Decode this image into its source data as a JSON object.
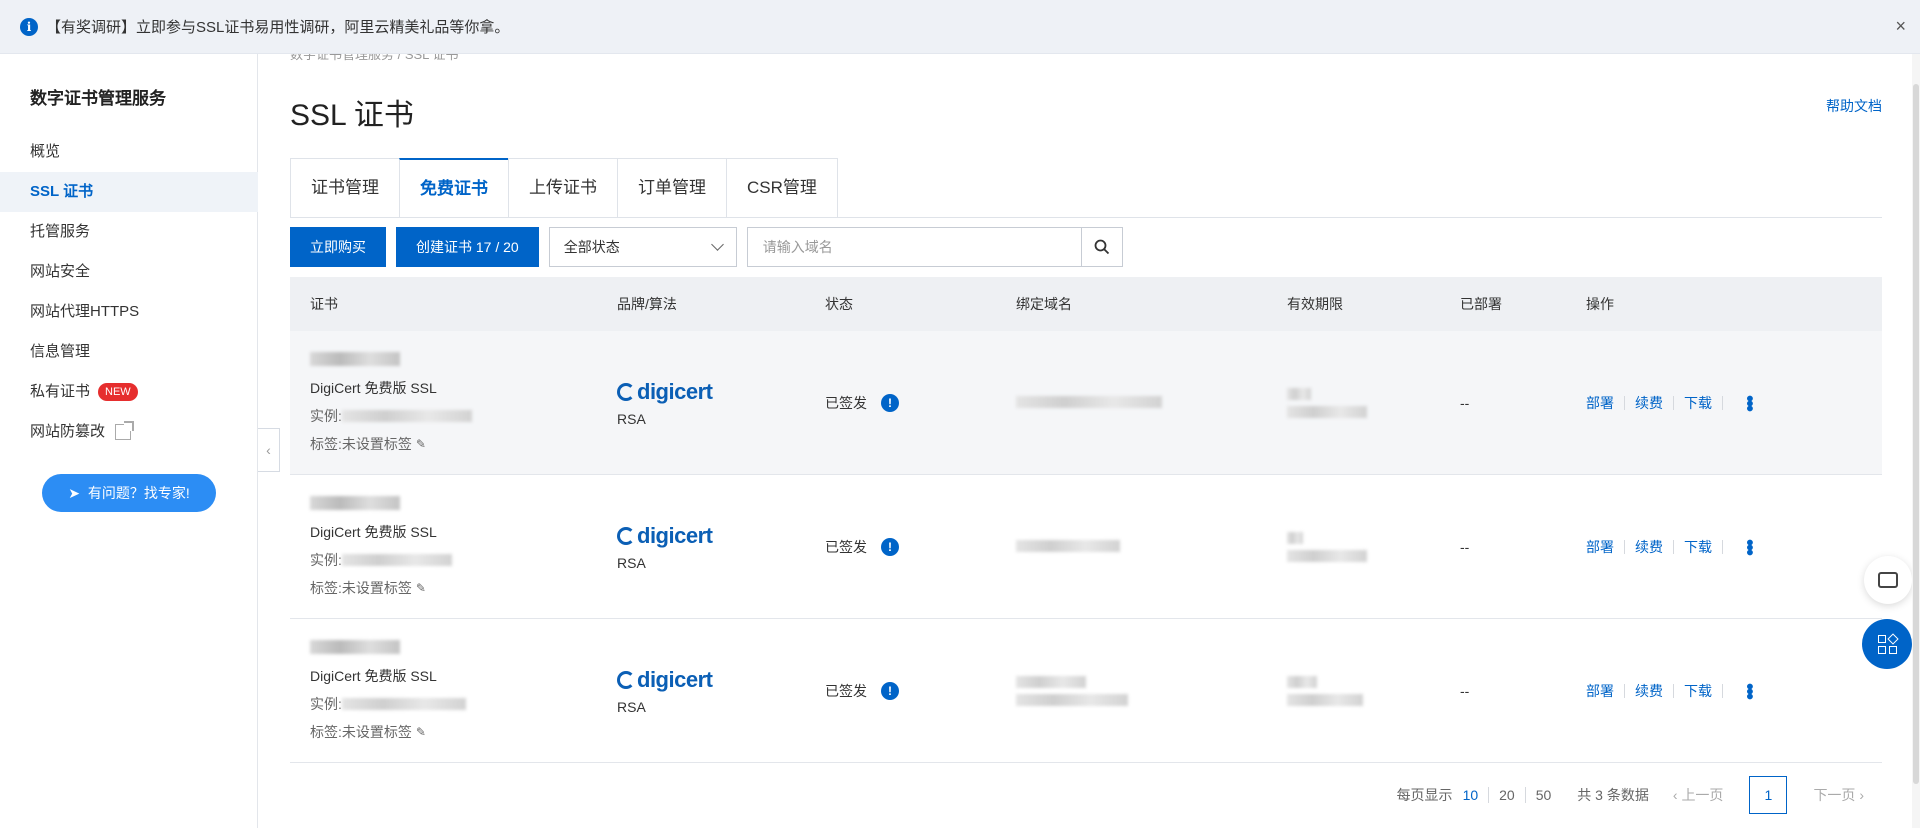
{
  "notice": {
    "icon": "info-icon",
    "text": "【有奖调研】立即参与SSL证书易用性调研，阿里云精美礼品等你拿。",
    "close": "×"
  },
  "sidebar": {
    "title": "数字证书管理服务",
    "items": [
      {
        "label": "概览"
      },
      {
        "label": "SSL 证书",
        "active": true
      },
      {
        "label": "托管服务"
      },
      {
        "label": "网站安全"
      },
      {
        "label": "网站代理HTTPS"
      },
      {
        "label": "信息管理"
      },
      {
        "label": "私有证书",
        "badge": "NEW"
      },
      {
        "label": "网站防篡改",
        "icon": "external-link-icon"
      }
    ],
    "expert_button": "有问题？找专家!",
    "collapse": "‹"
  },
  "main": {
    "breadcrumb": "数字证书管理服务  /  SSL 证书",
    "title": "SSL 证书",
    "help": "帮助文档",
    "tabs": [
      {
        "label": "证书管理"
      },
      {
        "label": "免费证书",
        "active": true
      },
      {
        "label": "上传证书"
      },
      {
        "label": "订单管理"
      },
      {
        "label": "CSR管理"
      }
    ],
    "toolbar": {
      "buy": "立即购买",
      "create": "创建证书 17 / 20",
      "status_select": "全部状态",
      "search_placeholder": "请输入域名"
    },
    "table": {
      "headers": [
        "证书",
        "品牌/算法",
        "状态",
        "绑定域名",
        "有效期限",
        "已部署",
        "操作"
      ],
      "rows": [
        {
          "type": "DigiCert 免费版 SSL",
          "instance_label": "实例:",
          "tag": "标签:未设置标签",
          "brand": "digicert",
          "algo": "RSA",
          "status": "已签发",
          "deployed": "--",
          "ops": [
            "部署",
            "续费",
            "下载"
          ]
        },
        {
          "type": "DigiCert 免费版 SSL",
          "instance_label": "实例:",
          "tag": "标签:未设置标签",
          "brand": "digicert",
          "algo": "RSA",
          "status": "已签发",
          "deployed": "--",
          "ops": [
            "部署",
            "续费",
            "下载"
          ]
        },
        {
          "type": "DigiCert 免费版 SSL",
          "instance_label": "实例:",
          "tag": "标签:未设置标签",
          "brand": "digicert",
          "algo": "RSA",
          "status": "已签发",
          "deployed": "--",
          "ops": [
            "部署",
            "续费",
            "下载"
          ]
        }
      ]
    },
    "pagination": {
      "page_size_label": "每页显示",
      "sizes": [
        "10",
        "20",
        "50"
      ],
      "active_size": "10",
      "total": "共 3 条数据",
      "prev": "上一页",
      "current": "1",
      "next": "下一页"
    }
  },
  "colors": {
    "accent": "#0064c8",
    "badge": "#e62e2e",
    "expert_button": "#2c8df4"
  }
}
